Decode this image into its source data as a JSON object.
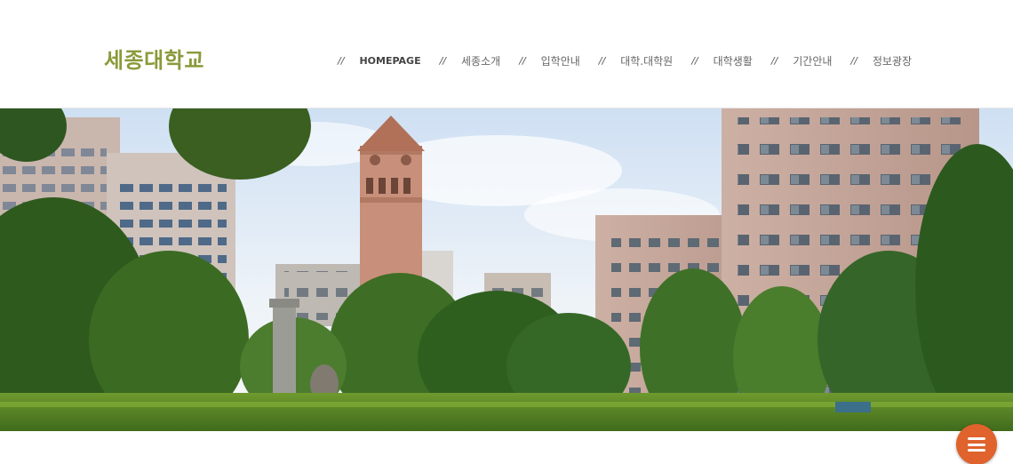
{
  "site": {
    "logo_text": "세종대학교",
    "brand_color": "#8a9a3a"
  },
  "nav": {
    "separator": "//",
    "items": [
      {
        "label": "HOMEPAGE",
        "active": true
      },
      {
        "label": "세종소개",
        "active": false
      },
      {
        "label": "입학안내",
        "active": false
      },
      {
        "label": "대학.대학원",
        "active": false
      },
      {
        "label": "대학생활",
        "active": false
      },
      {
        "label": "기간안내",
        "active": false
      },
      {
        "label": "정보광장",
        "active": false
      }
    ]
  },
  "hero": {
    "subject": "campus-photo-clock-tower"
  },
  "menu_button": {
    "icon": "menu-icon",
    "color": "#e0622c"
  }
}
